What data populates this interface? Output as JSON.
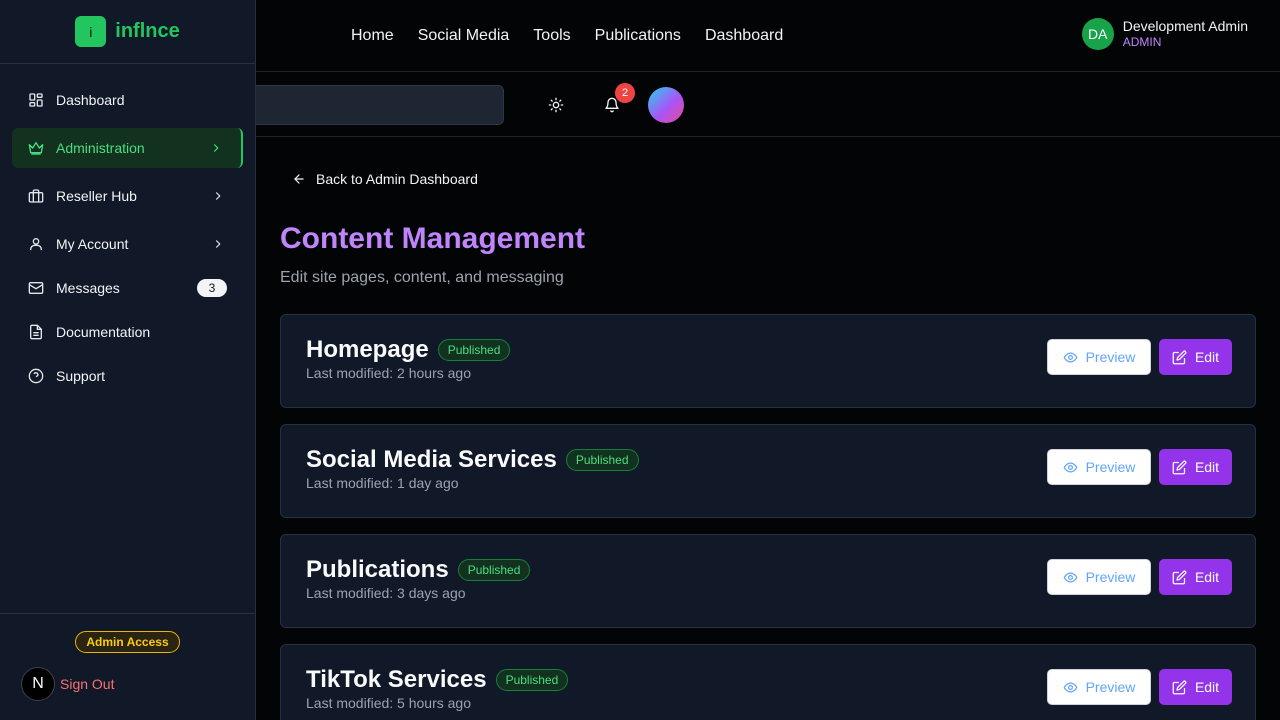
{
  "brand": {
    "logo_letter": "i",
    "name": "inflnce"
  },
  "top_nav": [
    "Home",
    "Social Media",
    "Tools",
    "Publications",
    "Dashboard"
  ],
  "user": {
    "initials": "DA",
    "name": "Development Admin",
    "role": "ADMIN"
  },
  "notifications": {
    "count": "2"
  },
  "sidebar": {
    "items": [
      {
        "label": "Dashboard",
        "icon": "dashboard-icon"
      },
      {
        "label": "Administration",
        "icon": "crown-icon",
        "active": true
      },
      {
        "label": "Reseller Hub",
        "icon": "briefcase-icon"
      },
      {
        "label": "My Account",
        "icon": "user-icon"
      },
      {
        "label": "Messages",
        "icon": "mail-icon",
        "badge": "3"
      },
      {
        "label": "Documentation",
        "icon": "document-icon"
      },
      {
        "label": "Support",
        "icon": "help-circle-icon"
      }
    ],
    "admin_access": "Admin Access",
    "avatar_letter": "N",
    "sign_out": "Sign Out"
  },
  "main": {
    "back_label": "Back to Admin Dashboard",
    "title": "Content Management",
    "subtitle": "Edit site pages, content, and messaging",
    "preview_label": "Preview",
    "edit_label": "Edit",
    "pages": [
      {
        "title": "Homepage",
        "status": "Published",
        "modified": "Last modified: 2 hours ago"
      },
      {
        "title": "Social Media Services",
        "status": "Published",
        "modified": "Last modified: 1 day ago"
      },
      {
        "title": "Publications",
        "status": "Published",
        "modified": "Last modified: 3 days ago"
      },
      {
        "title": "TikTok Services",
        "status": "Published",
        "modified": "Last modified: 5 hours ago"
      }
    ]
  },
  "colors": {
    "accent_green": "#22c55e",
    "accent_purple": "#c084fc",
    "edit_purple": "#9333ea",
    "notification_red": "#ef4444"
  }
}
